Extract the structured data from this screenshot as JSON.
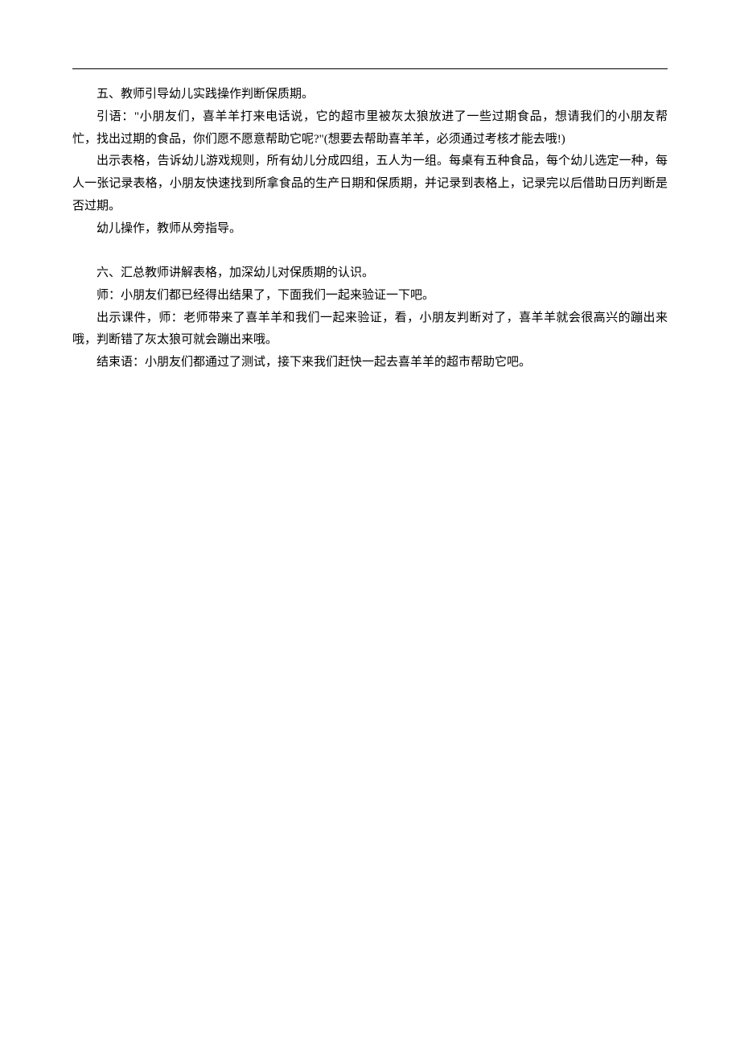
{
  "section1": {
    "heading": "五、教师引导幼儿实践操作判断保质期。",
    "p1": "引语：\"小朋友们，喜羊羊打来电话说，它的超市里被灰太狼放进了一些过期食品，想请我们的小朋友帮忙，找出过期的食品，你们愿不愿意帮助它呢?\"(想要去帮助喜羊羊，必须通过考核才能去哦!)",
    "p2": "出示表格，告诉幼儿游戏规则，所有幼儿分成四组，五人为一组。每桌有五种食品，每个幼儿选定一种，每人一张记录表格，小朋友快速找到所拿食品的生产日期和保质期，并记录到表格上，记录完以后借助日历判断是否过期。",
    "p3": "幼儿操作，教师从旁指导。"
  },
  "section2": {
    "heading": "六、汇总教师讲解表格，加深幼儿对保质期的认识。",
    "p1": "师：小朋友们都已经得出结果了，下面我们一起来验证一下吧。",
    "p2": "出示课件，师：老师带来了喜羊羊和我们一起来验证，看，小朋友判断对了，喜羊羊就会很高兴的蹦出来哦，判断错了灰太狼可就会蹦出来哦。",
    "p3": "结束语：小朋友们都通过了测试，接下来我们赶快一起去喜羊羊的超市帮助它吧。"
  }
}
